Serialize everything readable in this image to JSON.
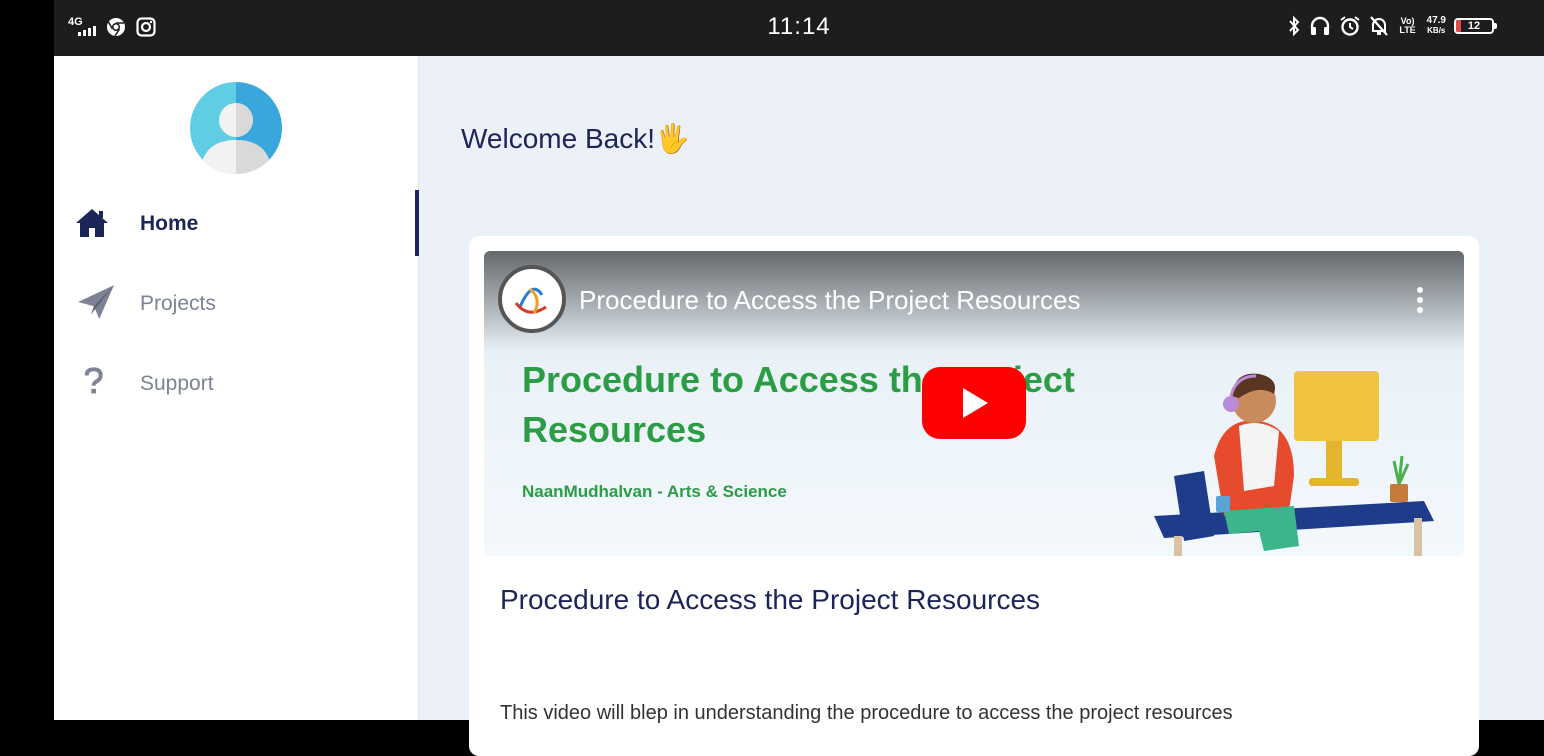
{
  "status_bar": {
    "network": "4G",
    "time": "11:14",
    "volte": "Vo) LTE",
    "speed_value": "47.9",
    "speed_unit": "KB/s",
    "battery_level": "12",
    "battery_color": "#e0484c"
  },
  "sidebar": {
    "items": [
      {
        "label": "Home",
        "icon": "home-icon",
        "active": true
      },
      {
        "label": "Projects",
        "icon": "paper-plane-icon",
        "active": false
      },
      {
        "label": "Support",
        "icon": "question-icon",
        "active": false
      }
    ]
  },
  "main": {
    "welcome": "Welcome Back!🖐",
    "video": {
      "title": "Procedure to Access the Project Resources",
      "thumbnail_title": "Procedure to Access the Project Resources",
      "thumbnail_subtitle": "NaanMudhalvan - Arts & Science"
    },
    "card_title": "Procedure to Access the Project Resources",
    "card_description": "This video will blep in understanding the procedure to access the project resources"
  },
  "colors": {
    "accent": "#1c2557",
    "background": "#ecf0f7",
    "thumbnail_text": "#2a9d45",
    "play_button": "#ff0000"
  }
}
